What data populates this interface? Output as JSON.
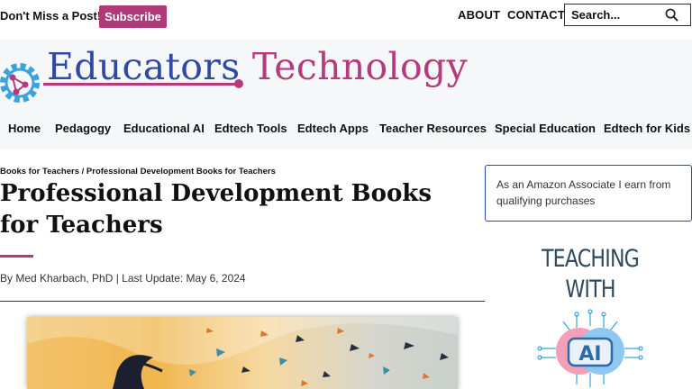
{
  "topbar": {
    "promo_text": "Don't Miss a Post!",
    "subscribe_label": "Subscribe",
    "links": [
      "ABOUT",
      "CONTACT"
    ],
    "search_placeholder": "Search..."
  },
  "brand": {
    "word1": "Educators",
    "word2": "Technology",
    "colors": {
      "blue": "#2f4aa3",
      "magenta": "#b43b7c",
      "gear": "#3aa3dd"
    }
  },
  "nav": {
    "items": [
      "Home",
      "Pedagogy",
      "Educational AI",
      "Edtech Tools",
      "Edtech Apps",
      "Teacher Resources",
      "Special Education",
      "Edtech for Kids"
    ]
  },
  "article": {
    "breadcrumb": [
      "Books for Teachers",
      "Professional Development Books for Teachers"
    ],
    "breadcrumb_separator": "/",
    "title": "Professional Development Books for Teachers",
    "meta": "By Med Kharbach, PhD | Last Update: May 6, 2024"
  },
  "sidebar": {
    "amazon_notice": "As an Amazon Associate I earn from qualifying purchases",
    "book": {
      "line1": "TEACHING",
      "line2": "WITH",
      "line3": "AI"
    }
  }
}
